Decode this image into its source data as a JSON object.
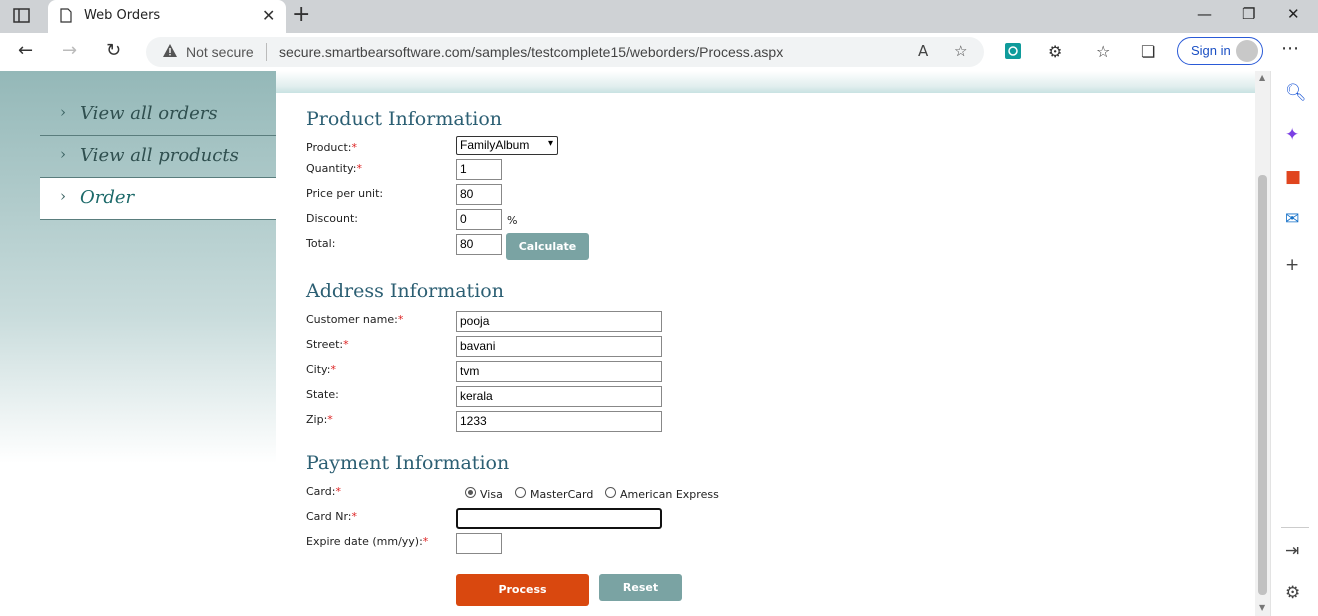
{
  "browser": {
    "tab_title": "Web Orders",
    "not_secure": "Not secure",
    "url": "secure.smartbearsoftware.com/samples/testcomplete15/weborders/Process.aspx",
    "sign_in": "Sign in"
  },
  "nav": {
    "items": [
      {
        "label": "View all orders",
        "active": false
      },
      {
        "label": "View all products",
        "active": false
      },
      {
        "label": "Order",
        "active": true
      }
    ]
  },
  "product": {
    "heading": "Product Information",
    "product_label": "Product:",
    "product_value": "FamilyAlbum",
    "quantity_label": "Quantity:",
    "quantity_value": "1",
    "price_label": "Price per unit:",
    "price_value": "80",
    "discount_label": "Discount:",
    "discount_value": "0",
    "discount_unit": "%",
    "total_label": "Total:",
    "total_value": "80",
    "calculate_label": "Calculate"
  },
  "address": {
    "heading": "Address Information",
    "customer_label": "Customer name:",
    "customer_value": "pooja",
    "street_label": "Street:",
    "street_value": "bavani",
    "city_label": "City:",
    "city_value": "tvm",
    "state_label": "State:",
    "state_value": "kerala",
    "zip_label": "Zip:",
    "zip_value": "1233"
  },
  "payment": {
    "heading": "Payment Information",
    "card_label": "Card:",
    "card_options": [
      "Visa",
      "MasterCard",
      "American Express"
    ],
    "card_selected": "Visa",
    "cardnr_label": "Card Nr:",
    "cardnr_value": "",
    "expire_label": "Expire date (mm/yy):",
    "expire_value": ""
  },
  "actions": {
    "process_label": "Process",
    "reset_label": "Reset"
  },
  "required_mark": "*",
  "colors": {
    "process": "#d9480f",
    "secondary_button": "#7aa3a3",
    "heading": "#2c5f73"
  }
}
